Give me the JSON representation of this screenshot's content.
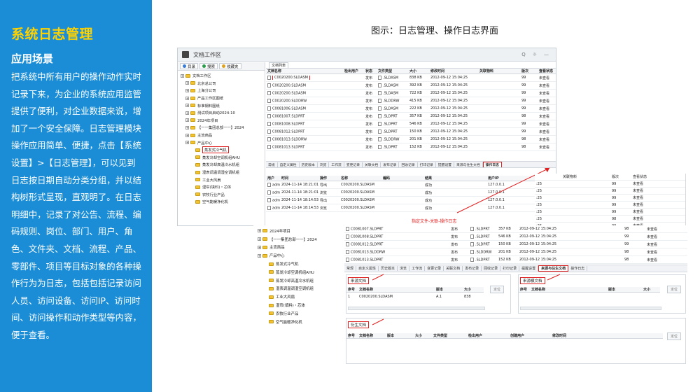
{
  "left": {
    "title": "系统日志管理",
    "subtitle": "应用场景",
    "body": "把系统中所有用户的操作动作实时记录下来，为企业的系统应用监管提供了便利，对企业数据来说，增加了一个安全保障。日志管理模块操作应用简单、便捷，点击【系统设置】>【日志管理】，可以见到日志按日期自动分类分组，并以结构树形式呈现，直观明了。在日志明细中，记录了对公告、流程、编码规则、岗位、部门、用户、角色、文件夹、文档、流程、产品、零部件、项目等目标对象的各种操作行为为日志，包括包括记录访问人员、访问设备、访问IP、访问时间、访问操作和动作类型等内容，便于查看。"
  },
  "caption": "图示：日志管理、操作日志界面",
  "window": {
    "title": "文档工作区",
    "toolbar_icons": [
      "Q",
      "☼",
      "—"
    ],
    "left_tabs": [
      {
        "label": "目录",
        "color": "#3a7bd5"
      },
      {
        "label": "搜索",
        "color": "#2a9d4a"
      },
      {
        "label": "收藏夹",
        "color": "#e0a020"
      }
    ],
    "tree": [
      {
        "label": "文档工作区",
        "level": 0,
        "plus": true
      },
      {
        "label": "北京总公司",
        "level": 1,
        "plus": true
      },
      {
        "label": "上海分公司",
        "level": 1,
        "plus": true
      },
      {
        "label": "产品工作区图纸",
        "level": 1,
        "plus": true
      },
      {
        "label": "标准钢料图纸",
        "level": 1,
        "plus": true
      },
      {
        "label": "测试项目启动2024-10",
        "level": 1,
        "plus": true
      },
      {
        "label": "2024年项目",
        "level": 1,
        "plus": true
      },
      {
        "label": "【一一集团总部一一】2024",
        "level": 1,
        "plus": true
      },
      {
        "label": "主流商品",
        "level": 1,
        "plus": true
      },
      {
        "label": "产品中心",
        "level": 1,
        "plus": true
      },
      {
        "label": "蒸发式冷气机",
        "level": 2,
        "plus": false,
        "selected": true
      },
      {
        "label": "蒸发冷却空调机组AHU",
        "level": 2,
        "plus": false
      },
      {
        "label": "蒸发冷却高温冷水机组",
        "level": 2,
        "plus": false
      },
      {
        "label": "湿表调温调湿空调机组",
        "level": 2,
        "plus": false
      },
      {
        "label": "工业大风扇",
        "level": 2,
        "plus": false
      },
      {
        "label": "湿帘(填料)・芯体",
        "level": 2,
        "plus": false
      },
      {
        "label": "农牧行业产品",
        "level": 2,
        "plus": false
      },
      {
        "label": "空气能暖净化机",
        "level": 2,
        "plus": false
      }
    ],
    "list_tab": "文档列表",
    "columns": [
      "文档名称",
      "检出用户",
      "状态",
      "文件类型",
      "大小",
      "修改时间",
      "关联物料",
      "版次",
      "查看状态"
    ],
    "rows": [
      {
        "name": "C0020200.SLDASM",
        "user": "",
        "status": "发布",
        "type": ".SLDASM",
        "size": "838 KB",
        "time": "2012-09-12 15:04:25",
        "rel": "",
        "ver": "99",
        "view": "未查看",
        "highlight": true
      },
      {
        "name": "C0020200.SLDASM",
        "user": "",
        "status": "发布",
        "type": ".SLDASM",
        "size": "392 KB",
        "time": "2012-09-12 15:04:25",
        "rel": "",
        "ver": "99",
        "view": "未查看"
      },
      {
        "name": "C0020200.SLDASM",
        "user": "",
        "status": "发布",
        "type": ".SLDASM",
        "size": "722 KB",
        "time": "2012-09-12 15:04:25",
        "rel": "",
        "ver": "99",
        "view": "未查看"
      },
      {
        "name": "C0020200.SLDDRW",
        "user": "",
        "status": "发布",
        "type": ".SLDDRW",
        "size": "415 KB",
        "time": "2012-09-12 15:04:25",
        "rel": "",
        "ver": "99",
        "view": "未查看"
      },
      {
        "name": "C0081006.SLDASM",
        "user": "",
        "status": "发布",
        "type": ".SLDASM",
        "size": "222 KB",
        "time": "2012-09-12 15:04:25",
        "rel": "",
        "ver": "99",
        "view": "未查看"
      },
      {
        "name": "C0081007.SLDPRT",
        "user": "",
        "status": "发布",
        "type": ".SLDPRT",
        "size": "357 KB",
        "time": "2012-09-12 15:04:25",
        "rel": "",
        "ver": "98",
        "view": "未查看"
      },
      {
        "name": "C0081008.SLDPRT",
        "user": "",
        "status": "发布",
        "type": ".SLDPRT",
        "size": "546 KB",
        "time": "2012-09-12 15:04:25",
        "rel": "",
        "ver": "99",
        "view": "未查看"
      },
      {
        "name": "C0081012.SLDPRT",
        "user": "",
        "status": "发布",
        "type": ".SLDPRT",
        "size": "150 KB",
        "time": "2012-09-12 15:04:25",
        "rel": "",
        "ver": "99",
        "view": "未查看"
      },
      {
        "name": "C0081013.SLDDRW",
        "user": "",
        "status": "发布",
        "type": ".SLDDRW",
        "size": "201 KB",
        "time": "2012-09-12 15:04:25",
        "rel": "",
        "ver": "98",
        "view": "未查看"
      },
      {
        "name": "C0081013.SLDPRT",
        "user": "",
        "status": "发布",
        "type": ".SLDPRT",
        "size": "152 KB",
        "time": "2012-09-12 15:04:25",
        "rel": "",
        "ver": "98",
        "view": "未查看"
      }
    ],
    "func_tabs": [
      "常规",
      "自定义属性",
      "历史版本",
      "浏览",
      "工作流",
      "变更记录",
      "关联文档",
      "发布记录",
      "回收记录",
      "打印记录",
      "提醒设置",
      "来源与往生文档",
      "操作日志"
    ],
    "func_tab_active": "操作日志",
    "log_columns": [
      "用户",
      "时间",
      "操作",
      "名称",
      "编码",
      "结果",
      "用户IP"
    ],
    "log_rows": [
      {
        "user": "admin",
        "time": "2024-11-14 18:21:01",
        "op": "导出",
        "name": "C0020200.SLDASM",
        "code": "",
        "result": "成功",
        "ip": "127.0.0.1"
      },
      {
        "user": "admin",
        "time": "2024-11-14 18:21:01",
        "op": "浏览",
        "name": "C0020200.SLDASM",
        "code": "",
        "result": "成功",
        "ip": "127.0.0.1"
      },
      {
        "user": "admin",
        "time": "2024-11-14 18:14:53",
        "op": "导出",
        "name": "C0020200.SLDASM",
        "code": "",
        "result": "成功",
        "ip": "127.0.0.1"
      },
      {
        "user": "admin",
        "time": "2024-11-14 18:14:53",
        "op": "浏览",
        "name": "C0020200.SLDASM",
        "code": "",
        "result": "成功",
        "ip": "127.0.0.1"
      }
    ],
    "callout": "指定文件-关联-操作日志"
  },
  "overlap": {
    "columns": [
      "关联物料",
      "版次",
      "查看状态"
    ],
    "rows": [
      {
        "time": ":25",
        "ver": "99",
        "view": "未查看"
      },
      {
        "time": ":25",
        "ver": "99",
        "view": "未查看"
      },
      {
        "time": ":25",
        "ver": "99",
        "view": "未查看"
      },
      {
        "time": ":25",
        "ver": "99",
        "view": "未查看"
      },
      {
        "time": ":25",
        "ver": "99",
        "view": "未查看"
      },
      {
        "time": ":25",
        "ver": "98",
        "view": "未查看"
      },
      {
        "time": ":25",
        "ver": "99",
        "view": "未查看"
      }
    ]
  },
  "window2": {
    "tree": [
      {
        "label": "2024年项目",
        "level": 0,
        "plus": true
      },
      {
        "label": "【一一集团总部一一】2024",
        "level": 0,
        "plus": true
      },
      {
        "label": "主流商品",
        "level": 0,
        "plus": true
      },
      {
        "label": "产品中心",
        "level": 0,
        "plus": true
      },
      {
        "label": "蒸发式冷气机",
        "level": 1,
        "plus": false
      },
      {
        "label": "蒸发冷却空调机组AHU",
        "level": 1,
        "plus": false
      },
      {
        "label": "蒸发冷却高温冷水机组",
        "level": 1,
        "plus": false
      },
      {
        "label": "湿表调温调湿空调机组",
        "level": 1,
        "plus": false
      },
      {
        "label": "工业大风扇",
        "level": 1,
        "plus": false
      },
      {
        "label": "湿帘(填料)・芯体",
        "level": 1,
        "plus": false
      },
      {
        "label": "农牧行业产品",
        "level": 1,
        "plus": false
      },
      {
        "label": "空气能暖净化机",
        "level": 1,
        "plus": false
      }
    ],
    "rows": [
      {
        "name": "C0081007.SLDPRT",
        "status": "发布",
        "type": ".SLDPRT",
        "size": "357 KB",
        "time": "2012-09-12 15:04:25",
        "ver": "98",
        "view": "未查看"
      },
      {
        "name": "C0081008.SLDPRT",
        "status": "发布",
        "type": ".SLDPRT",
        "size": "546 KB",
        "time": "2012-09-12 15:04:25",
        "ver": "99",
        "view": "未查看"
      },
      {
        "name": "C0081012.SLDPRT",
        "status": "发布",
        "type": ".SLDPRT",
        "size": "150 KB",
        "time": "2012-09-12 15:04:25",
        "ver": "99",
        "view": "未查看"
      },
      {
        "name": "C0081013.SLDDRW",
        "status": "发布",
        "type": ".SLDDRW",
        "size": "201 KB",
        "time": "2012-09-12 15:04:25",
        "ver": "98",
        "view": "未查看"
      },
      {
        "name": "C0081013.SLDPRT",
        "status": "发布",
        "type": ".SLDPRT",
        "size": "152 KB",
        "time": "2012-09-12 15:04:25",
        "ver": "98",
        "view": "未查看"
      }
    ],
    "func_tabs": [
      "常规",
      "自定义属性",
      "历史版本",
      "浏览",
      "工作流",
      "变更记录",
      "关联文档",
      "发布记录",
      "回收记录",
      "打印记录",
      "提醒设置",
      "来源与往生文档",
      "操作日志"
    ],
    "func_tab_active": "来源与往生文档",
    "source_panel_title": "来源文档",
    "source_columns": [
      "序号",
      "文档名称",
      "版本",
      "大小"
    ],
    "source_row": {
      "no": "1",
      "name": "C0020200.SLDASM",
      "ver": "A.1",
      "size": "838"
    },
    "target_panel_title": "来源模文档",
    "target_columns": [
      "序号",
      "文档名称",
      "版本",
      "大小"
    ],
    "derived_panel_title": "衍生文档",
    "derived_columns": [
      "序号",
      "文档名称",
      "版本",
      "大小",
      "文件类型",
      "检出用户",
      "创建用户",
      "修改时间"
    ],
    "btn_locate": "定位"
  }
}
